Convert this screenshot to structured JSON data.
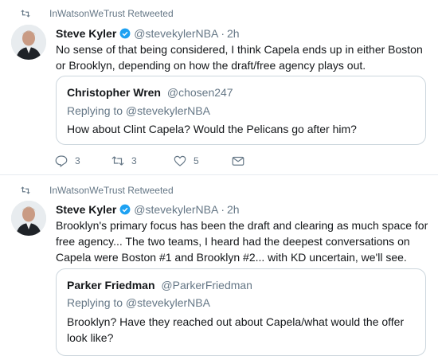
{
  "tweets": [
    {
      "retweeted_by": "InWatsonWeTrust Retweeted",
      "author_name": "Steve Kyler",
      "author_handle": "@stevekylerNBA",
      "separator": "·",
      "time": "2h",
      "text": "No sense of that being considered, I think Capela ends up in either Boston or Brooklyn, depending on how the draft/free agency plays out.",
      "quote": {
        "name": "Christopher Wren",
        "handle": "@chosen247",
        "replying_to": "Replying to @stevekylerNBA",
        "text": "How about Clint Capela? Would the Pelicans go after him?"
      },
      "actions": {
        "replies": "3",
        "retweets": "3",
        "likes": "5"
      }
    },
    {
      "retweeted_by": "InWatsonWeTrust Retweeted",
      "author_name": "Steve Kyler",
      "author_handle": "@stevekylerNBA",
      "separator": "·",
      "time": "2h",
      "text": "Brooklyn's primary focus has been the draft and clearing as much space for free agency... The two teams, I heard had the deepest conversations on Capela were Boston #1 and Brooklyn #2... with KD uncertain, we'll see.",
      "quote": {
        "name": "Parker Friedman",
        "handle": "@ParkerFriedman",
        "replying_to": "Replying to @stevekylerNBA",
        "text": "Brooklyn? Have they reached out about Capela/what would the offer look like?"
      }
    }
  ],
  "colors": {
    "verified": "#1da1f2",
    "muted": "#657786",
    "border": "#ccd6dd"
  },
  "icons": [
    "retweet-icon",
    "reply-icon",
    "like-icon",
    "message-icon",
    "verified-badge-icon"
  ]
}
